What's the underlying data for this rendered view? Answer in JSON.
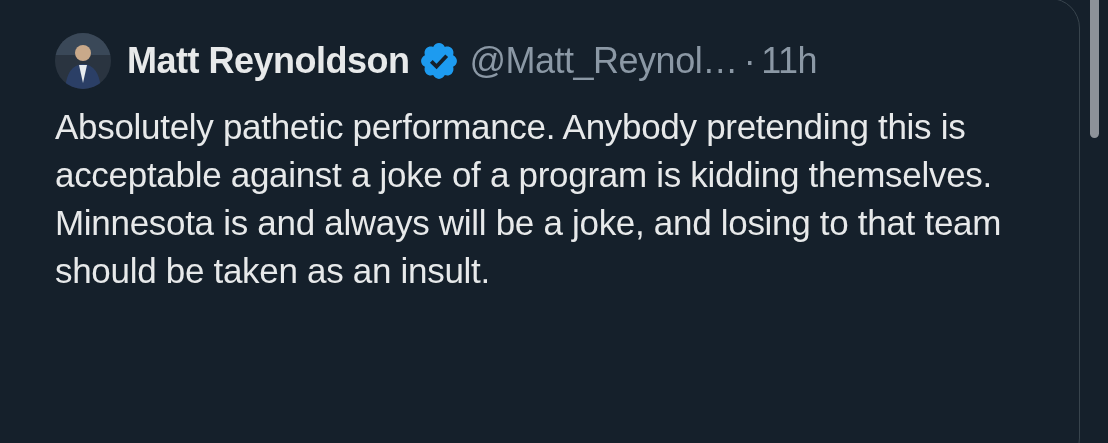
{
  "tweet": {
    "author": {
      "name": "Matt Reynoldson",
      "verified": true,
      "handle": "@Matt_Reynol…",
      "separator": "·",
      "time": "11h"
    },
    "text": "Absolutely pathetic performance. Anybody pretending this is acceptable against a joke of a program is kidding themselves. Minnesota is and always will be a joke, and losing to that team should be taken as an insult."
  }
}
